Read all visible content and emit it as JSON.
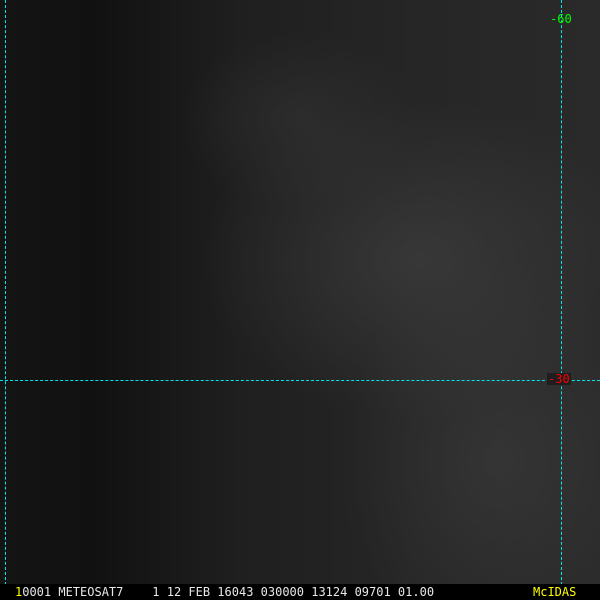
{
  "image": {
    "satellite": "METEOSAT7"
  },
  "grid": {
    "color": "#00e5e5",
    "labels": [
      {
        "text": "-60",
        "color": "#00ff00"
      },
      {
        "text": "-30",
        "color": "#ff0000"
      }
    ]
  },
  "status_bar": {
    "frame_number": "1",
    "info": "0001 METEOSAT7    1 12 FEB 16043 030000 13124 09701 01.00",
    "brand": "McIDAS",
    "brand_color": "#ffff00"
  }
}
